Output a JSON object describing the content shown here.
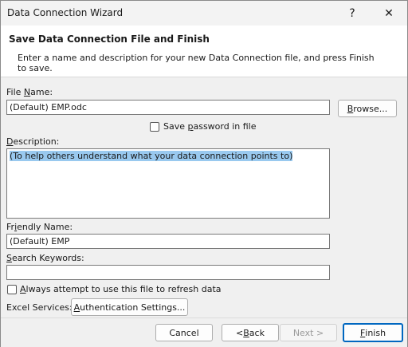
{
  "window": {
    "title": "Data Connection Wizard",
    "help_glyph": "?",
    "close_glyph": "✕"
  },
  "header": {
    "title": "Save Data Connection File and Finish",
    "description": "Enter a name and description for your new Data Connection file, and press Finish to save."
  },
  "file_name": {
    "label_prefix": "File ",
    "label_u": "N",
    "label_rest": "ame:",
    "value": "(Default) EMP.odc"
  },
  "browse_button": {
    "label_u": "B",
    "label_rest": "rowse..."
  },
  "save_password": {
    "label_pre": "Save ",
    "label_u": "p",
    "label_rest": "assword in file",
    "checked": false
  },
  "description": {
    "label_u": "D",
    "label_rest": "escription:",
    "value": "(To help others understand what your data connection points to)"
  },
  "friendly_name": {
    "label_pre": "Fr",
    "label_u": "i",
    "label_rest": "endly Name:",
    "value": "(Default) EMP"
  },
  "search_keywords": {
    "label_u": "S",
    "label_rest": "earch Keywords:",
    "value": ""
  },
  "always_refresh": {
    "label_u": "A",
    "label_rest": "lways attempt to use this file to refresh data",
    "checked": false
  },
  "excel_services": {
    "label": "Excel Services:",
    "auth_button_u": "A",
    "auth_button_rest": "uthentication Settings..."
  },
  "buttons": {
    "cancel": "Cancel",
    "back_pre": "< ",
    "back_u": "B",
    "back_rest": "ack",
    "next": "Next >",
    "finish_u": "F",
    "finish_rest": "inish"
  },
  "colors": {
    "accent": "#0067c0",
    "selection": "#99c9ef"
  }
}
